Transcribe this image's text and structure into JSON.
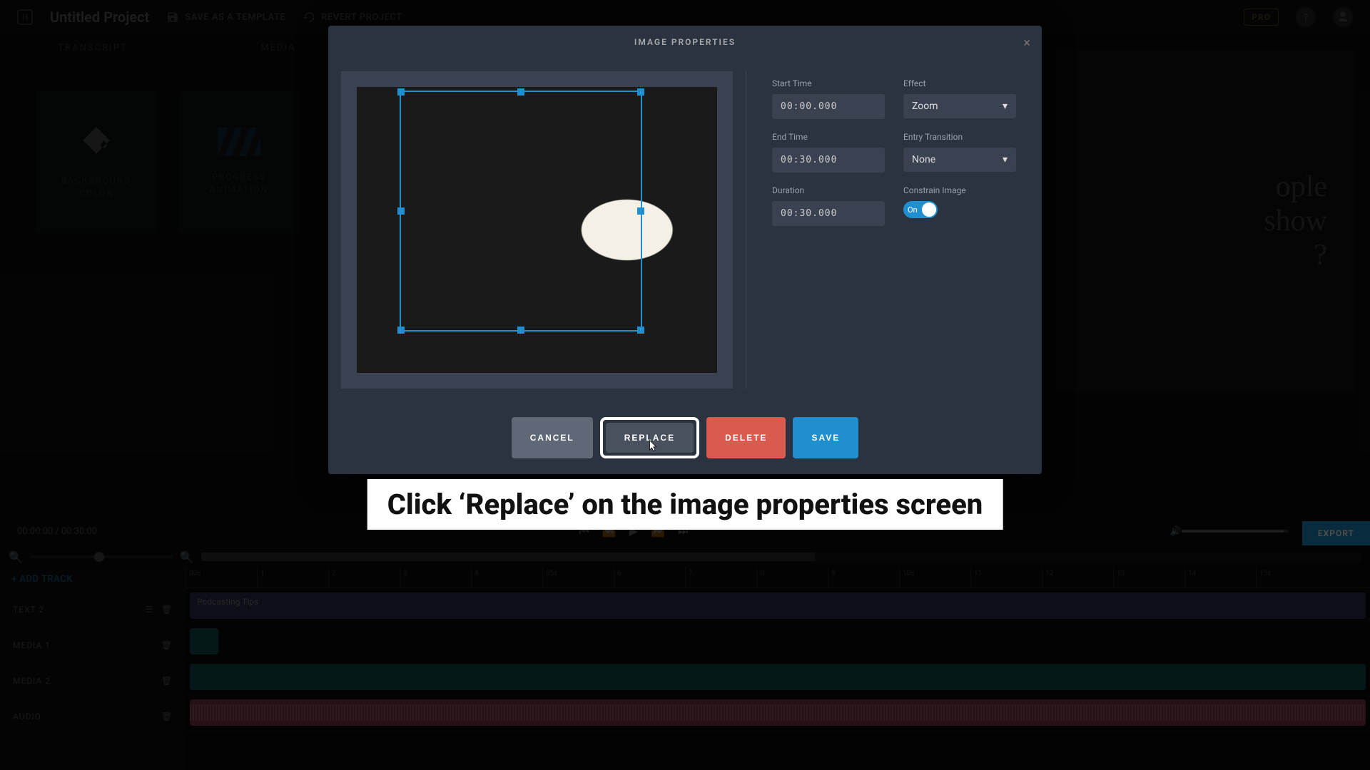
{
  "header": {
    "project_title": "Untitled Project",
    "save_template": "SAVE AS A TEMPLATE",
    "revert": "REVERT PROJECT",
    "pro": "PRO"
  },
  "tabs": {
    "transcript": "TRANSCRIPT",
    "media": "MEDIA"
  },
  "cards": {
    "bgcolor": "BACKGROUND\nCOLOR",
    "progress": "PROGRESS\nANIMATION"
  },
  "preview": {
    "line1": "ople",
    "line2": "show",
    "line3": "?"
  },
  "player": {
    "time_current": "00:00:00",
    "time_total": "00:30:00",
    "export": "EXPORT"
  },
  "tracks": {
    "add": "+ ADD TRACK",
    "text2": "TEXT 2",
    "text2_clip": "Podcasting Tips",
    "media1": "MEDIA 1",
    "media2": "MEDIA 2",
    "audio": "AUDIO",
    "ruler": [
      "00s",
      "1",
      "2",
      "3",
      "4",
      "05s",
      "6",
      "7",
      "8",
      "9",
      "10s",
      "11",
      "12",
      "13",
      "14",
      "15s"
    ]
  },
  "modal": {
    "title": "IMAGE PROPERTIES",
    "fields": {
      "start_time_label": "Start Time",
      "start_time": "00:00.000",
      "end_time_label": "End Time",
      "end_time": "00:30.000",
      "duration_label": "Duration",
      "duration": "00:30.000",
      "effect_label": "Effect",
      "effect": "Zoom",
      "entry_label": "Entry Transition",
      "entry": "None",
      "constrain_label": "Constrain Image",
      "constrain": "On"
    },
    "buttons": {
      "cancel": "CANCEL",
      "replace": "REPLACE",
      "delete": "DELETE",
      "save": "SAVE"
    }
  },
  "banner": "Click ‘Replace’ on the image properties screen"
}
